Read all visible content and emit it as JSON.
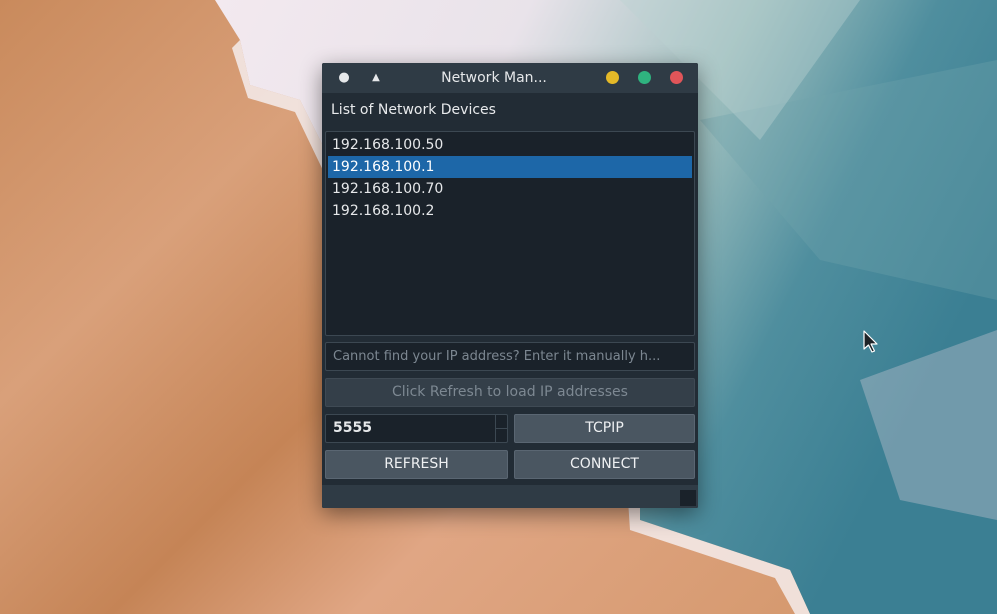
{
  "window": {
    "title": "Network Man...",
    "icons": {
      "menu": "dot-icon",
      "keep_above": "triangle-up-icon",
      "minimize": "minimize-icon",
      "maximize": "maximize-icon",
      "close": "close-icon"
    },
    "colors": {
      "minimize": "#e4b928",
      "maximize": "#2fb37f",
      "close": "#e05559",
      "selection": "#1d67a8"
    }
  },
  "main": {
    "list_label": "List of Network Devices",
    "devices": [
      {
        "label": "192.168.100.50",
        "selected": false
      },
      {
        "label": "192.168.100.1",
        "selected": true
      },
      {
        "label": "192.168.100.70",
        "selected": false
      },
      {
        "label": "192.168.100.2",
        "selected": false
      }
    ],
    "manual_input": {
      "value": "",
      "placeholder": "Cannot find your IP address? Enter it manually h..."
    },
    "status_label": "Click Refresh to load IP addresses",
    "port": {
      "value": "5555"
    },
    "buttons": {
      "tcpip": "TCPIP",
      "refresh": "REFRESH",
      "connect": "CONNECT"
    }
  }
}
